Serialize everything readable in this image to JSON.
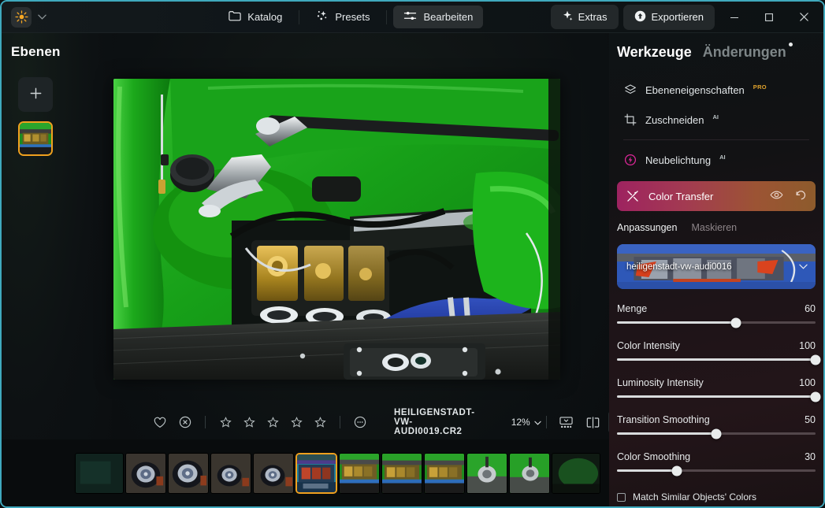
{
  "titlebar": {
    "logo_icon": "sun-icon",
    "dropdown_icon": "chevron-down-icon",
    "nav": [
      {
        "id": "katalog",
        "label": "Katalog",
        "icon": "folder-icon",
        "active": false
      },
      {
        "id": "presets",
        "label": "Presets",
        "icon": "sparkle-icon",
        "active": false
      },
      {
        "id": "bearbeiten",
        "label": "Bearbeiten",
        "icon": "sliders-icon",
        "active": true
      }
    ],
    "extras_label": "Extras",
    "extras_icon": "sparkle-icon",
    "export_label": "Exportieren",
    "export_icon": "upload-circle-icon",
    "minimize_icon": "minimize-icon",
    "maximize_icon": "maximize-icon",
    "close_icon": "close-icon"
  },
  "left_panel": {
    "title": "Ebenen",
    "add_button_icon": "plus-icon",
    "layer_thumbnail_name": "layer-thumbnail"
  },
  "bottom_bar": {
    "favorite_icon": "heart-icon",
    "reject_icon": "reject-circle-icon",
    "stars": 5,
    "star_icon": "star-outline-icon",
    "more_icon": "more-circle-icon",
    "filename": "HEILIGENSTADT-VW-AUDI0019.CR2",
    "zoom_level": "12%",
    "zoom_chevron_icon": "chevron-down-icon",
    "filmstrip_toggle_icon": "filmstrip-icon",
    "compare_icon": "compare-split-icon",
    "hide_edits_icon": "eye-off-icon"
  },
  "filmstrip": {
    "item_count": 12,
    "current_index": 5
  },
  "right_panel": {
    "tab_tools": "Werkzeuge",
    "tab_changes": "Änderungen",
    "changes_has_indicator": true,
    "tools": [
      {
        "id": "layer-properties",
        "label": "Ebeneneigenschaften",
        "icon": "layers-icon",
        "badge": "PRO"
      },
      {
        "id": "crop",
        "label": "Zuschneiden",
        "icon": "crop-icon",
        "badge": "AI"
      },
      {
        "id": "relight",
        "label": "Neubelichtung",
        "icon": "relight-icon",
        "badge": "AI"
      }
    ],
    "color_transfer": {
      "title": "Color Transfer",
      "icon": "color-transfer-icon",
      "visibility_icon": "eye-icon",
      "reset_icon": "undo-icon",
      "gradient_from": "#9e2360",
      "gradient_to": "#8d5b2c",
      "tabs": [
        {
          "id": "anpassungen",
          "label": "Anpassungen",
          "active": true
        },
        {
          "id": "maskieren",
          "label": "Maskieren",
          "active": false
        }
      ],
      "preset": {
        "label": "heiligenstadt-vw-audi0016",
        "chevron_icon": "chevron-down-icon"
      },
      "sliders": [
        {
          "id": "menge",
          "label": "Menge",
          "value": 60,
          "max": 100
        },
        {
          "id": "color-intensity",
          "label": "Color Intensity",
          "value": 100,
          "max": 100
        },
        {
          "id": "luminosity-intensity",
          "label": "Luminosity Intensity",
          "value": 100,
          "max": 100
        },
        {
          "id": "transition-smoothing",
          "label": "Transition Smoothing",
          "value": 50,
          "max": 100
        },
        {
          "id": "color-smoothing",
          "label": "Color Smoothing",
          "value": 30,
          "max": 100
        }
      ],
      "checkbox": {
        "label": "Match Similar Objects' Colors",
        "checked": false
      }
    }
  },
  "colors": {
    "window_border": "#3fa9bd",
    "accent_orange": "#f0a01e",
    "panel_dark": "#0c1012"
  }
}
